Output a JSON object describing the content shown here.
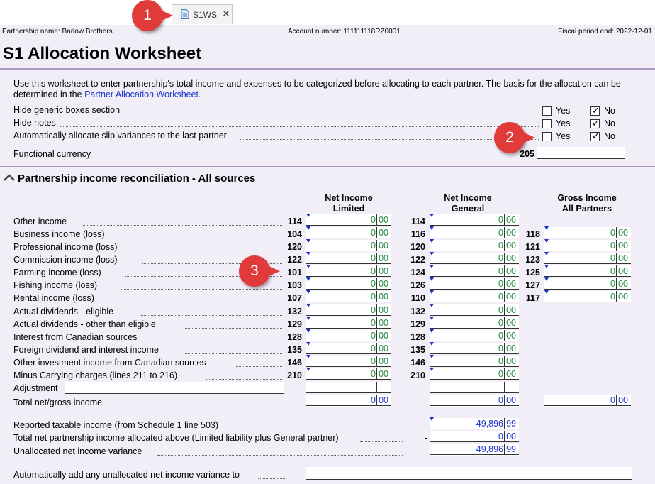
{
  "tab": {
    "label": "S1WS",
    "close": "✕"
  },
  "callouts": [
    "1",
    "2",
    "3"
  ],
  "header": {
    "partnership": "Partnership name: Barlow Brothers",
    "account": "Account number: 111111118RZ0001",
    "fiscal": "Fiscal period end: 2022-12-01",
    "title": "S1 Allocation Worksheet"
  },
  "intro": {
    "text": "Use this worksheet to enter partnership's total income and expenses to be categorized before allocating to each partner. The basis for the allocation can be determined in the ",
    "link": "Partner Allocation Worksheet",
    "end": "."
  },
  "options": [
    {
      "label": "Hide generic boxes section",
      "yes": "Yes",
      "no": "No",
      "value": "No"
    },
    {
      "label": "Hide notes",
      "yes": "Yes",
      "no": "No",
      "value": "No"
    },
    {
      "label": "Automatically allocate slip variances to the last partner",
      "yes": "Yes",
      "no": "No",
      "value": "No"
    }
  ],
  "currency": {
    "label": "Functional currency",
    "line": "205",
    "value": ""
  },
  "section_title": "Partnership income reconciliation - All sources",
  "columns": [
    {
      "l1": "Net Income",
      "l2": "Limited"
    },
    {
      "l1": "Net Income",
      "l2": "General"
    },
    {
      "l1": "Gross Income",
      "l2": "All Partners"
    }
  ],
  "rows": [
    {
      "label": "Other income",
      "a": "114",
      "b": "114",
      "c": ""
    },
    {
      "label": "Business income (loss)",
      "a": "104",
      "b": "116",
      "c": "118"
    },
    {
      "label": "Professional income (loss)",
      "a": "120",
      "b": "120",
      "c": "121"
    },
    {
      "label": "Commission income (loss)",
      "a": "122",
      "b": "122",
      "c": "123"
    },
    {
      "label": "Farming income (loss)",
      "a": "101",
      "b": "124",
      "c": "125"
    },
    {
      "label": "Fishing income (loss)",
      "a": "103",
      "b": "126",
      "c": "127"
    },
    {
      "label": "Rental income (loss)",
      "a": "107",
      "b": "110",
      "c": "117"
    },
    {
      "label": "Actual dividends - eligible",
      "a": "132",
      "b": "132",
      "c": ""
    },
    {
      "label": "Actual dividends - other than eligible",
      "a": "129",
      "b": "129",
      "c": ""
    },
    {
      "label": "Interest from Canadian sources",
      "a": "128",
      "b": "128",
      "c": ""
    },
    {
      "label": "Foreign dividend and interest income",
      "a": "135",
      "b": "135",
      "c": ""
    },
    {
      "label": "Other investment income from Canadian sources",
      "a": "146",
      "b": "146",
      "c": ""
    },
    {
      "label": "Minus Carrying charges (lines 211 to 216)",
      "a": "210",
      "b": "210",
      "c": ""
    }
  ],
  "cell_int": "0",
  "cell_dec": "00",
  "adjustment_label": "Adjustment",
  "total_label": "Total net/gross income",
  "reported": {
    "label": "Reported taxable income (from Schedule 1 line 503)",
    "int": "49,896",
    "dec": "99"
  },
  "allocated": {
    "label": "Total net partnership income allocated above (Limited liability plus General partner)",
    "sign": "-",
    "int": "0",
    "dec": "00"
  },
  "unallocated": {
    "label": "Unallocated net income variance",
    "int": "49,896",
    "dec": "99"
  },
  "auto_add": {
    "label": "Automatically add any unallocated net income variance to",
    "value": ""
  }
}
